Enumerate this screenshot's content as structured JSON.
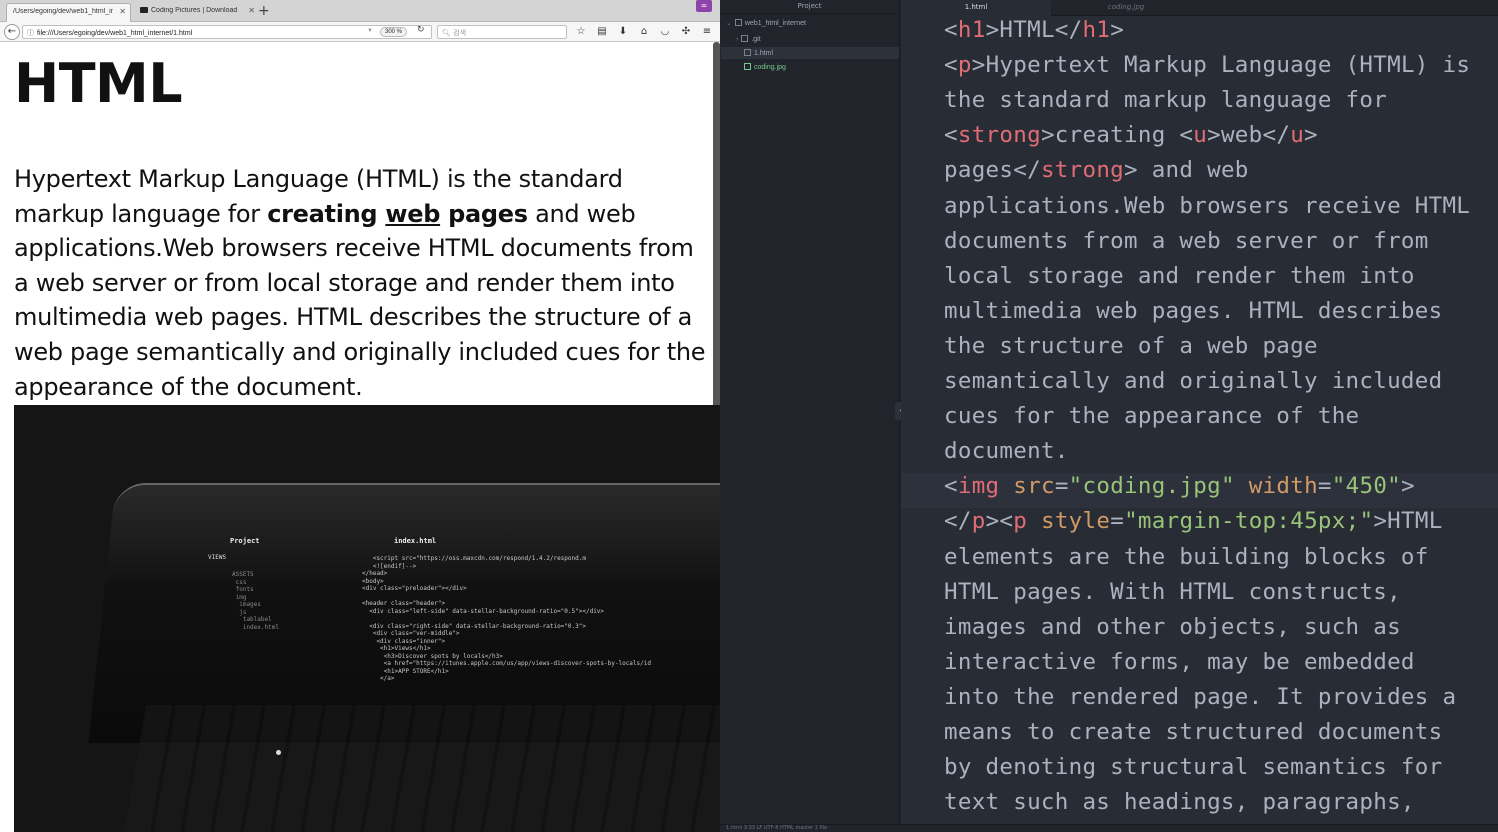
{
  "browser": {
    "tabs": [
      {
        "title": "/Users/egoing/dev/web1_html_inte",
        "active": true
      },
      {
        "title": "Coding Pictures | Download F",
        "active": false
      }
    ],
    "new_tab": "+",
    "extension_badge": "∞",
    "back": "←",
    "url": "file:///Users/egoing/dev/web1_html_internet/1.html",
    "zoom": "300 %",
    "search_placeholder": "검색",
    "icons": [
      "bookmark-star-icon",
      "reader-icon",
      "download-icon",
      "home-icon",
      "pocket-icon",
      "extension-icon",
      "menu-icon"
    ]
  },
  "page": {
    "heading": "HTML",
    "para_1": "Hypertext Markup Language (HTML) is the standard markup language for ",
    "strong_1": "creating ",
    "strong_u": "web",
    "strong_2": " pages",
    "para_2": " and web applications.Web browsers receive HTML documents from a web server or from local storage and render them into multimedia web pages. HTML describes the structure of a web page semantically and originally included cues for the appearance of the document."
  },
  "photo": {
    "screen_project": "Project",
    "screen_views": "VIEWS",
    "screen_file": "index.html",
    "screen_code": "   <script src=\"https://oss.maxcdn.com/respond/1.4.2/respond.m\n   <![endif]-->\n</head>\n<body>\n<div class=\"preloader\"></div>\n\n<header class=\"header\">\n  <div class=\"left-side\" data-stellar-background-ratio=\"0.5\"></div>\n\n  <div class=\"right-side\" data-stellar-background-ratio=\"0.3\">\n   <div class=\"ver-middle\">\n    <div class=\"inner\">\n     <h1>Views</h1>\n      <h3>Discover spots by locals</h3>\n      <a href=\"https://itunes.apple.com/us/app/views-discover-spots-by-locals/id\n      <h1>APP STORE</h1>\n     </a>",
    "screen_tree": "ASSETS\n css\n fonts\n img\n  images\n  js\n   tablabel\n   index.html"
  },
  "editor": {
    "tree_header": "Project",
    "root_folder": "web1_html_internet",
    "items": [
      ".git",
      "1.html",
      "coding.jpg"
    ],
    "tabs": [
      "1.html",
      "coding.jpg"
    ],
    "status": "1.html   3:33                                                                                                   LF   UTF-8   HTML   master   1 file"
  },
  "code_lines": [
    [
      [
        "<",
        "pl"
      ],
      [
        "h1",
        "tg"
      ],
      [
        ">HTML</",
        "pl"
      ],
      [
        "h1",
        "tg"
      ],
      [
        ">",
        "pl"
      ]
    ],
    [
      [
        "<",
        "pl"
      ],
      [
        "p",
        "tg"
      ],
      [
        ">Hypertext Markup Language (HTML) is",
        "pl"
      ]
    ],
    [
      [
        "the standard markup language for",
        "pl"
      ]
    ],
    [
      [
        "<",
        "pl"
      ],
      [
        "strong",
        "tg"
      ],
      [
        ">creating <",
        "pl"
      ],
      [
        "u",
        "tg"
      ],
      [
        ">web</",
        "pl"
      ],
      [
        "u",
        "tg"
      ],
      [
        ">",
        "pl"
      ]
    ],
    [
      [
        "pages</",
        "pl"
      ],
      [
        "strong",
        "tg"
      ],
      [
        "> and web",
        "pl"
      ]
    ],
    [
      [
        "applications.Web browsers receive HTML",
        "pl"
      ]
    ],
    [
      [
        "documents from a web server or from",
        "pl"
      ]
    ],
    [
      [
        "local storage and render them into",
        "pl"
      ]
    ],
    [
      [
        "multimedia web pages. HTML describes",
        "pl"
      ]
    ],
    [
      [
        "the structure of a web page",
        "pl"
      ]
    ],
    [
      [
        "semantically and originally included",
        "pl"
      ]
    ],
    [
      [
        "cues for the appearance of the",
        "pl"
      ]
    ],
    [
      [
        "document.",
        "pl"
      ]
    ],
    [
      [
        "<",
        "pl"
      ],
      [
        "img",
        "tg"
      ],
      [
        " ",
        "pl"
      ],
      [
        "src",
        "at"
      ],
      [
        "=",
        "pl"
      ],
      [
        "\"coding.jpg\"",
        "st"
      ],
      [
        " ",
        "pl"
      ],
      [
        "width",
        "at"
      ],
      [
        "=",
        "pl"
      ],
      [
        "\"450\"",
        "st"
      ],
      [
        ">",
        "pl"
      ]
    ],
    [
      [
        "</",
        "pl"
      ],
      [
        "p",
        "tg"
      ],
      [
        "><",
        "pl"
      ],
      [
        "p",
        "tg"
      ],
      [
        " ",
        "pl"
      ],
      [
        "style",
        "at"
      ],
      [
        "=",
        "pl"
      ],
      [
        "\"margin-top:45px;\"",
        "st"
      ],
      [
        ">HTML",
        "pl"
      ]
    ],
    [
      [
        "elements are the building blocks of",
        "pl"
      ]
    ],
    [
      [
        "HTML pages. With HTML constructs,",
        "pl"
      ]
    ],
    [
      [
        "images and other objects, such as",
        "pl"
      ]
    ],
    [
      [
        "interactive forms, may be embedded",
        "pl"
      ]
    ],
    [
      [
        "into the rendered page. It provides a",
        "pl"
      ]
    ],
    [
      [
        "means to create structured documents",
        "pl"
      ]
    ],
    [
      [
        "by denoting structural semantics for",
        "pl"
      ]
    ],
    [
      [
        "text such as headings, paragraphs,",
        "pl"
      ]
    ]
  ],
  "cursor_line": 13
}
